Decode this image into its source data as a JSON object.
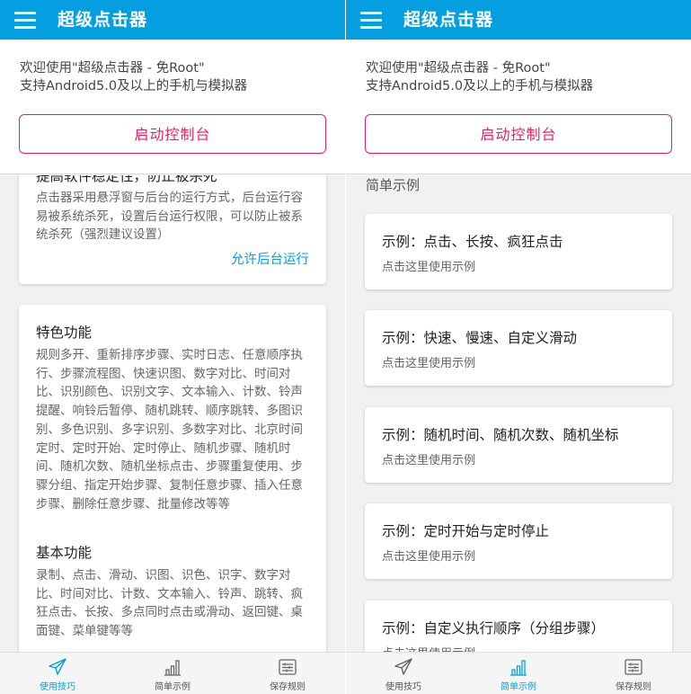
{
  "left": {
    "app_title": "超级点击器",
    "welcome_line1": "欢迎使用\"超级点击器 - 免Root\"",
    "welcome_line2": "支持Android5.0及以上的手机与模拟器",
    "launch_button": "启动控制台",
    "card1": {
      "title": "提高软件稳定性，防止被杀死",
      "body": "点击器采用悬浮窗与后台的运行方式，后台运行容易被系统杀死，设置后台运行权限，可以防止被系统杀死（强烈建议设置）",
      "link": "允许后台运行"
    },
    "card2": {
      "title1": "特色功能",
      "body1": "规则多开、重新排序步骤、实时日志、任意顺序执行、步骤流程图、快速识图、数字对比、时间对比、识别颜色、识别文字、文本输入、计数、铃声提醒、响铃后暂停、随机跳转、顺序跳转、多图识别、多色识别、多字识别、多数字对比、北京时间定时、定时开始、定时停止、随机步骤、随机时间、随机次数、随机坐标点击、步骤重复使用、步骤分组、指定开始步骤、复制任意步骤、插入任意步骤、删除任意步骤、批量修改等等",
      "title2": "基本功能",
      "body2": "录制、点击、滑动、识图、识色、识字、数字对比、时间对比、计数、文本输入、铃声、跳转、疯狂点击、长按、多点同时点击或滑动、返回键、桌面键、菜单键等等"
    },
    "nav": [
      {
        "label": "使用技巧",
        "icon": "send-icon",
        "active": true
      },
      {
        "label": "简单示例",
        "icon": "bar-chart-icon",
        "active": false
      },
      {
        "label": "保存规则",
        "icon": "rules-list-icon",
        "active": false
      }
    ]
  },
  "right": {
    "app_title": "超级点击器",
    "welcome_line1": "欢迎使用\"超级点击器 - 免Root\"",
    "welcome_line2": "支持Android5.0及以上的手机与模拟器",
    "launch_button": "启动控制台",
    "section_label": "简单示例",
    "examples": [
      {
        "title": "示例：点击、长按、疯狂点击",
        "sub": "点击这里使用示例"
      },
      {
        "title": "示例：快速、慢速、自定义滑动",
        "sub": "点击这里使用示例"
      },
      {
        "title": "示例：随机时间、随机次数、随机坐标",
        "sub": "点击这里使用示例"
      },
      {
        "title": "示例：定时开始与定时停止",
        "sub": "点击这里使用示例"
      },
      {
        "title": "示例：自定义执行顺序（分组步骤）",
        "sub": "点击这里使用示例"
      }
    ],
    "nav": [
      {
        "label": "使用技巧",
        "icon": "send-icon",
        "active": false
      },
      {
        "label": "简单示例",
        "icon": "bar-chart-icon",
        "active": true
      },
      {
        "label": "保存规则",
        "icon": "rules-list-icon",
        "active": false
      }
    ]
  },
  "colors": {
    "appbar": "#039fe0",
    "accent_pink": "#e91e63",
    "link_blue": "#039fe0"
  }
}
